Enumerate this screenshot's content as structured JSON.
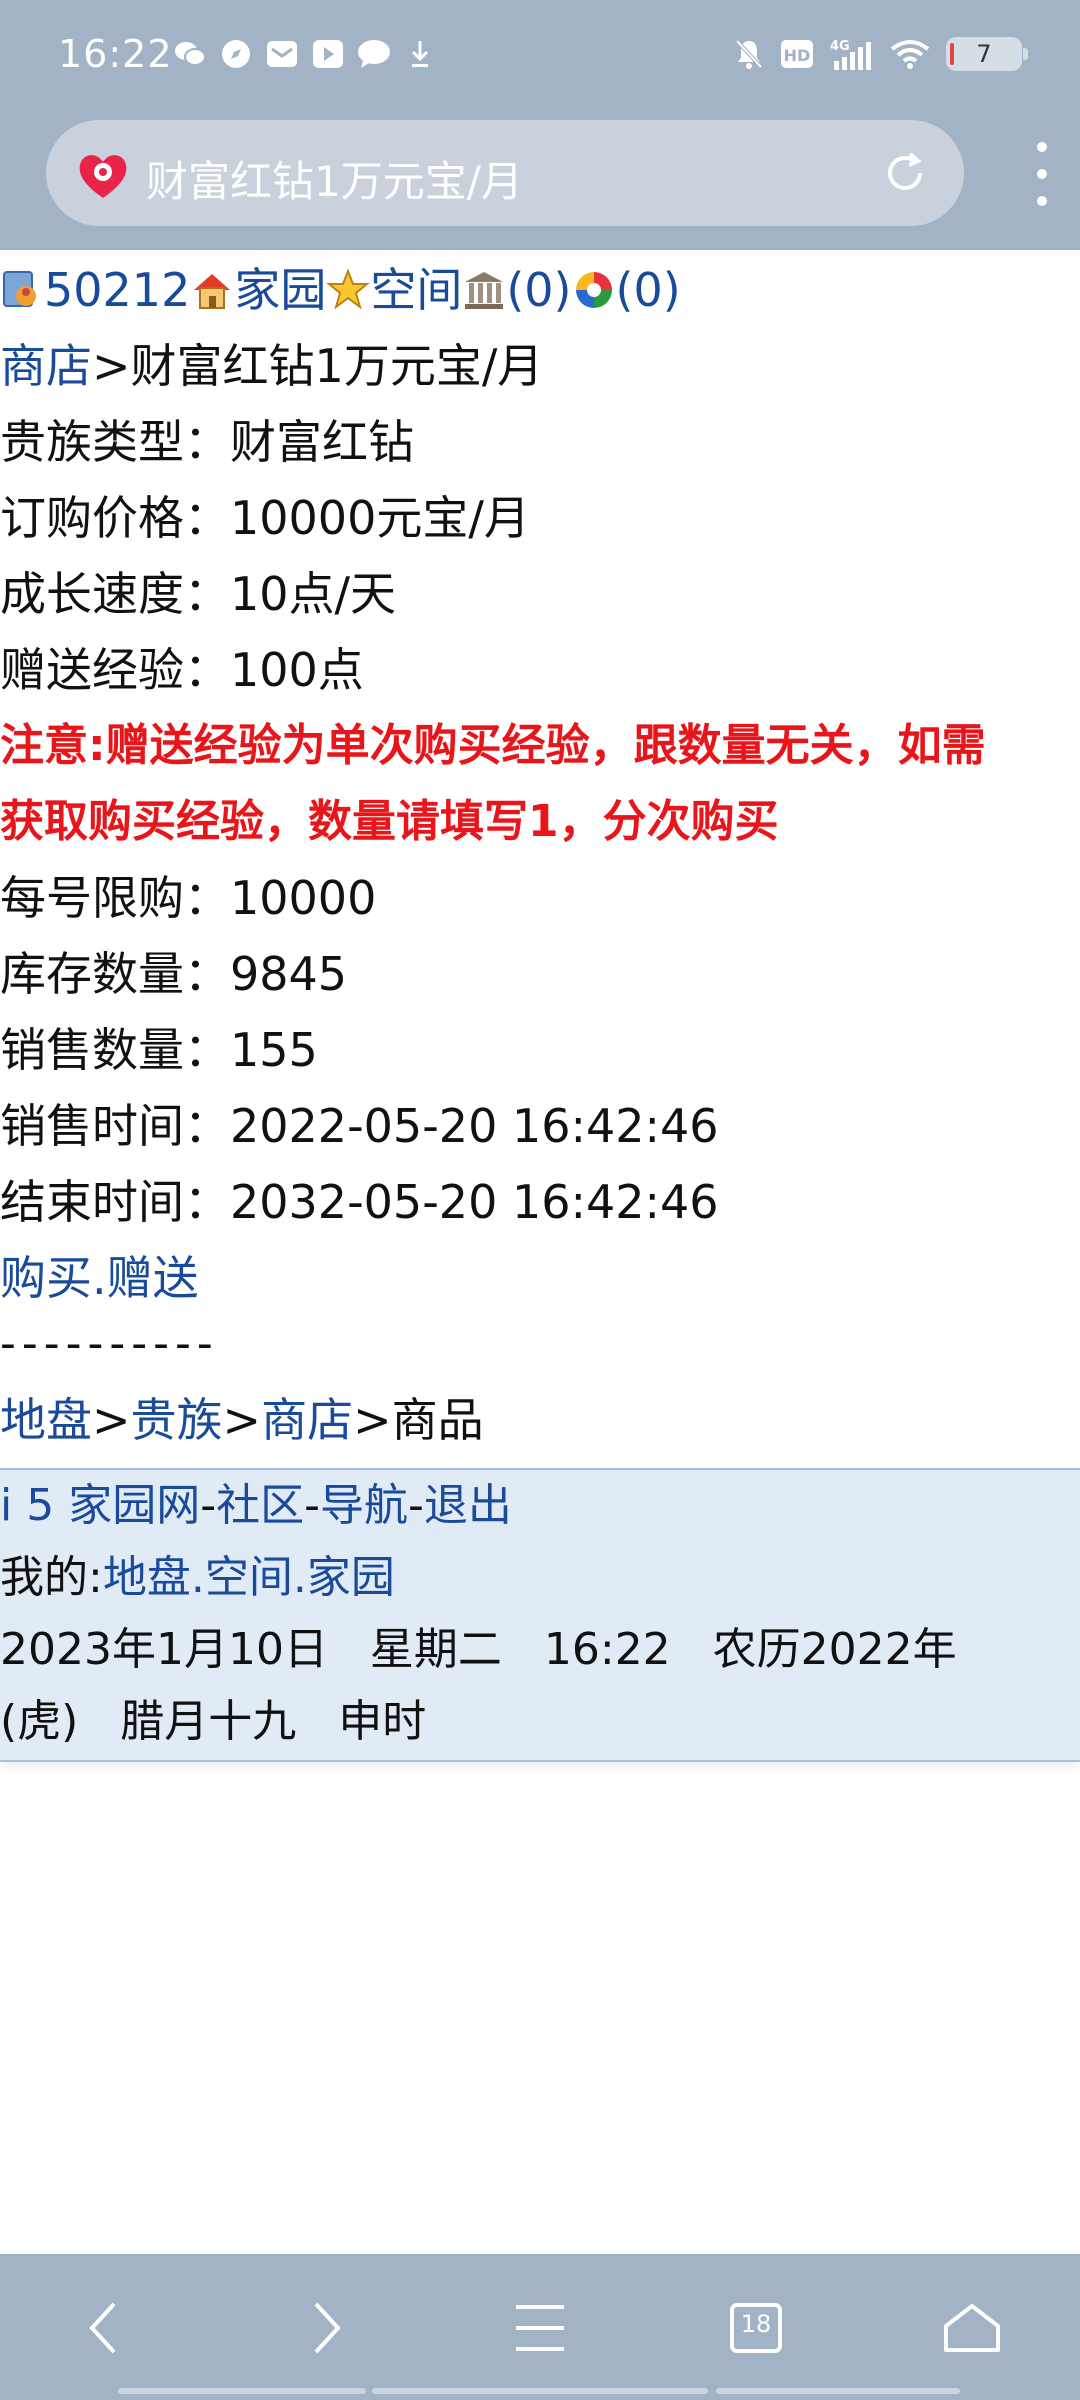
{
  "status_bar": {
    "time": "16:22",
    "battery": "7",
    "network": "4G",
    "hd": "HD"
  },
  "url_bar": {
    "title": "财富红钻1万元宝/月"
  },
  "header_links": {
    "user_id": "50212",
    "home": "家园",
    "space": "空间",
    "bank_count": "(0)",
    "album_count": "(0)"
  },
  "breadcrumb_top": {
    "shop": "商店",
    "sep": ">",
    "current": "财富红钻1万元宝/月"
  },
  "details": [
    {
      "label": "贵族类型：",
      "value": "财富红钻"
    },
    {
      "label": "订购价格：",
      "value": "10000元宝/月"
    },
    {
      "label": "成长速度：",
      "value": "10点/天"
    },
    {
      "label": "赠送经验：",
      "value": "100点"
    }
  ],
  "notice": {
    "line1": "注意:赠送经验为单次购买经验，跟数量无关，如需",
    "line2": "获取购买经验，数量请填写1，分次购买"
  },
  "details2": [
    {
      "label": "每号限购：",
      "value": "10000"
    },
    {
      "label": "库存数量：",
      "value": "9845"
    },
    {
      "label": "销售数量：",
      "value": "155"
    },
    {
      "label": "销售时间：",
      "value": "2022-05-20 16:42:46"
    },
    {
      "label": "结束时间：",
      "value": "2032-05-20 16:42:46"
    }
  ],
  "actions": {
    "buy": "购买",
    "dot": ".",
    "gift": "赠送"
  },
  "divider": "----------",
  "breadcrumb_bottom": {
    "land": "地盘",
    "noble": "贵族",
    "shop": "商店",
    "goods": "商品",
    "sep": ">"
  },
  "footer": {
    "site": "i 5 家园网",
    "community": "社区",
    "nav": "导航",
    "logout": "退出",
    "dash": "-",
    "mine_label": "我的:",
    "mine_land": "地盘",
    "mine_space": "空间",
    "mine_home": "家园",
    "dot": ".",
    "date_line1": "2023年1月10日   星期二   16:22   农历2022年",
    "date_line2": "(虎)   腊月十九   申时"
  },
  "bottom_nav": {
    "tab_count": "18"
  },
  "colors": {
    "chrome": "#a2b3c6",
    "link": "#1a4b9a",
    "warning": "#e8161a",
    "footer_bg": "#e1ebf6"
  }
}
